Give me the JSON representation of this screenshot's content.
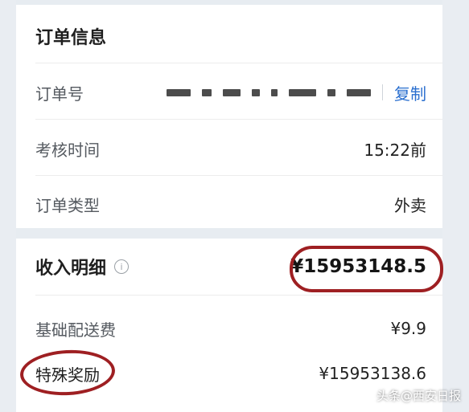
{
  "order_section": {
    "title": "订单信息",
    "rows": {
      "order_no": {
        "label": "订单号",
        "copy_label": "复制"
      },
      "check_time": {
        "label": "考核时间",
        "value": "15:22前"
      },
      "order_type": {
        "label": "订单类型",
        "value": "外卖"
      }
    }
  },
  "income_section": {
    "title": "收入明细",
    "total": "¥15953148.5",
    "rows": {
      "base_fee": {
        "label": "基础配送费",
        "value": "¥9.9"
      },
      "special_bonus": {
        "label": "特殊奖励",
        "value": "¥15953138.6"
      }
    }
  },
  "watermark": {
    "text": "头条@西安日报"
  },
  "colors": {
    "accent_link": "#2a6fcf",
    "annotation_circle": "#9e1f22"
  }
}
